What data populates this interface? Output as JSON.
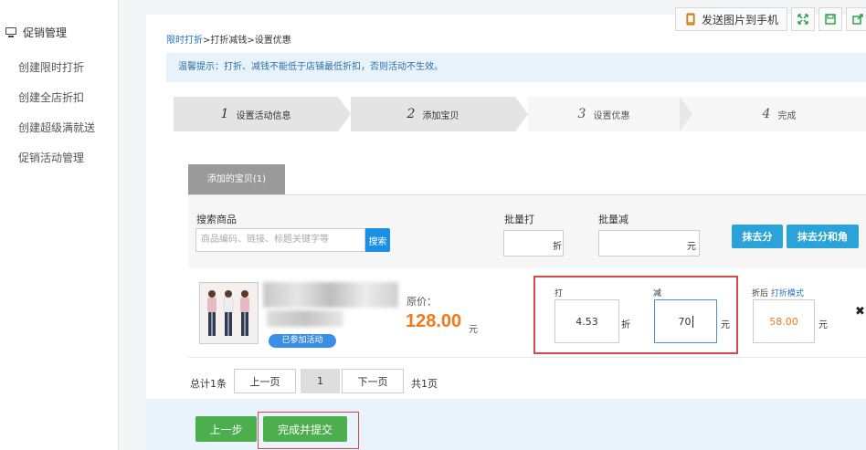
{
  "sidebar": {
    "section_title": "促销管理",
    "items": [
      {
        "label": "创建限时打折"
      },
      {
        "label": "创建全店折扣"
      },
      {
        "label": "创建超级满就送"
      },
      {
        "label": "促销活动管理"
      }
    ]
  },
  "toolbar": {
    "send_label": "发送图片到手机",
    "icons": [
      "phone-icon",
      "expand-icon",
      "save-icon",
      "share-icon"
    ]
  },
  "breadcrumb": {
    "link": "限时打折",
    "rest": ">打折减钱>设置优惠"
  },
  "tip": "温馨提示：打折、减钱不能低于店铺最低折扣，否则活动不生效。",
  "steps": [
    {
      "num": "1",
      "label": "设置活动信息"
    },
    {
      "num": "2",
      "label": "添加宝贝"
    },
    {
      "num": "3",
      "label": "设置优惠"
    },
    {
      "num": "4",
      "label": "完成"
    }
  ],
  "panel": {
    "tab_label": "添加的宝贝(1)",
    "search_label": "搜索商品",
    "search_placeholder": "商品编码、链接、标题关键字等",
    "search_button": "搜索",
    "batch_discount_label": "批量打",
    "batch_discount_unit": "折",
    "batch_reduce_label": "批量减",
    "batch_reduce_unit": "元",
    "round_fen_button": "抹去分",
    "round_fen_jiao_button": "抹去分和角"
  },
  "item": {
    "joined_badge": "已参加活动",
    "price_label": "原价：",
    "price": "128.00",
    "price_unit": "元",
    "discount_label": "打",
    "discount_value": "4.53",
    "discount_unit": "折",
    "reduce_label": "减",
    "reduce_value": "70",
    "reduce_unit": "元",
    "after_label": "折后",
    "after_mode_link": "打折模式",
    "after_value": "58.00",
    "after_unit": "元",
    "close_glyph": "✖"
  },
  "pager": {
    "total": "总计1条",
    "prev": "上一页",
    "current": "1",
    "next": "下一页",
    "pages": "共1页"
  },
  "actions": {
    "back": "上一步",
    "submit": "完成并提交"
  },
  "colors": {
    "accent_blue": "#1a8fe6",
    "price_orange": "#f07a1c",
    "highlight_red": "#d84848",
    "green": "#4cae4c"
  }
}
